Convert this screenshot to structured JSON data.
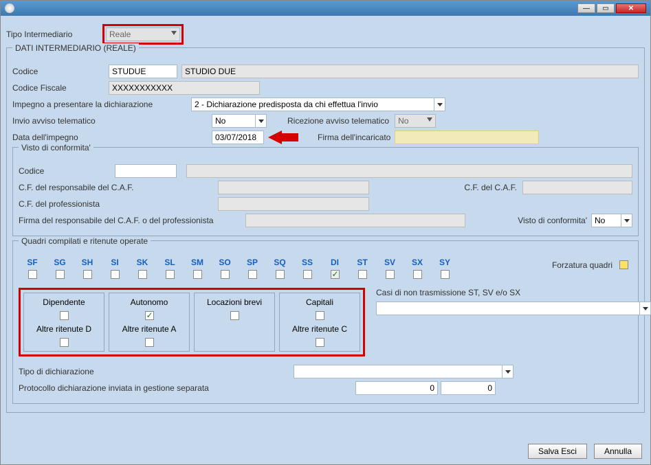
{
  "labels": {
    "tipo_intermediario": "Tipo Intermediario",
    "dati_intermediario": "DATI INTERMEDIARIO (REALE)",
    "codice": "Codice",
    "codice_fiscale": "Codice Fiscale",
    "impegno": "Impegno a presentare la dichiarazione",
    "invio_avviso": "Invio avviso telematico",
    "ricezione_avviso": "Ricezione avviso telematico",
    "data_impegno": "Data dell'impegno",
    "firma_incaricato": "Firma dell'incaricato",
    "visto_conformita": "Visto di conformita'",
    "visto_codice": "Codice",
    "cf_resp_caf": "C.F. del responsabile del C.A.F.",
    "cf_caf": "C.F. del C.A.F.",
    "cf_professionista": "C.F. del professionista",
    "firma_resp": "Firma del responsabile del C.A.F. o del professionista",
    "visto_conf_sel": "Visto di conformita'",
    "quadri_title": "Quadri compilati e ritenute operate",
    "forzatura": "Forzatura quadri",
    "casi_non_trasm": "Casi di non trasmissione ST, SV e/o SX",
    "tipo_dich": "Tipo di dichiarazione",
    "protocollo": "Protocollo dichiarazione inviata in gestione separata",
    "salva_esci": "Salva Esci",
    "annulla": "Annulla"
  },
  "values": {
    "tipo_intermediario": "Reale",
    "codice": "STUDUE",
    "codice_desc": "STUDIO DUE",
    "codice_fiscale": "XXXXXXXXXXX",
    "impegno_sel": "2 - Dichiarazione predisposta da chi effettua l'invio",
    "invio_avviso": "No",
    "ricezione_avviso": "No",
    "data_impegno": "03/07/2018",
    "visto_conf_sel": "No",
    "proto_a": "0",
    "proto_b": "0"
  },
  "quadri": {
    "headers": [
      "SF",
      "SG",
      "SH",
      "SI",
      "SK",
      "SL",
      "SM",
      "SO",
      "SP",
      "SQ",
      "SS",
      "DI",
      "ST",
      "SV",
      "SX",
      "SY"
    ],
    "checked_index": 11
  },
  "groups": [
    {
      "top": "Dipendente",
      "top_checked": false,
      "bottom": "Altre ritenute D",
      "bottom_checked": false,
      "has_bottom": true
    },
    {
      "top": "Autonomo",
      "top_checked": true,
      "bottom": "Altre ritenute A",
      "bottom_checked": false,
      "has_bottom": true
    },
    {
      "top": "Locazioni brevi",
      "top_checked": false,
      "has_bottom": false
    },
    {
      "top": "Capitali",
      "top_checked": false,
      "bottom": "Altre ritenute C",
      "bottom_checked": false,
      "has_bottom": true
    }
  ]
}
